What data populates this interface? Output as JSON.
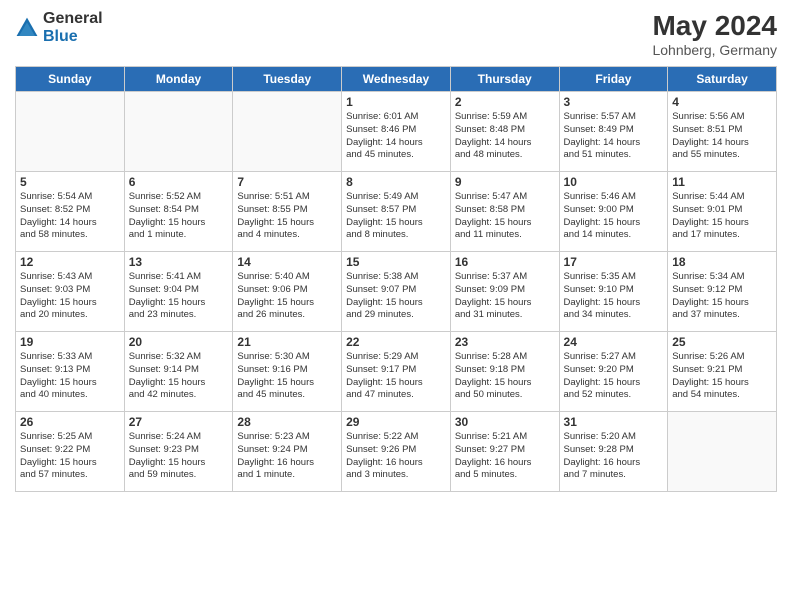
{
  "header": {
    "logo_line1": "General",
    "logo_line2": "Blue",
    "month_year": "May 2024",
    "location": "Lohnberg, Germany"
  },
  "weekdays": [
    "Sunday",
    "Monday",
    "Tuesday",
    "Wednesday",
    "Thursday",
    "Friday",
    "Saturday"
  ],
  "weeks": [
    [
      {
        "day": "",
        "info": ""
      },
      {
        "day": "",
        "info": ""
      },
      {
        "day": "",
        "info": ""
      },
      {
        "day": "1",
        "info": "Sunrise: 6:01 AM\nSunset: 8:46 PM\nDaylight: 14 hours\nand 45 minutes."
      },
      {
        "day": "2",
        "info": "Sunrise: 5:59 AM\nSunset: 8:48 PM\nDaylight: 14 hours\nand 48 minutes."
      },
      {
        "day": "3",
        "info": "Sunrise: 5:57 AM\nSunset: 8:49 PM\nDaylight: 14 hours\nand 51 minutes."
      },
      {
        "day": "4",
        "info": "Sunrise: 5:56 AM\nSunset: 8:51 PM\nDaylight: 14 hours\nand 55 minutes."
      }
    ],
    [
      {
        "day": "5",
        "info": "Sunrise: 5:54 AM\nSunset: 8:52 PM\nDaylight: 14 hours\nand 58 minutes."
      },
      {
        "day": "6",
        "info": "Sunrise: 5:52 AM\nSunset: 8:54 PM\nDaylight: 15 hours\nand 1 minute."
      },
      {
        "day": "7",
        "info": "Sunrise: 5:51 AM\nSunset: 8:55 PM\nDaylight: 15 hours\nand 4 minutes."
      },
      {
        "day": "8",
        "info": "Sunrise: 5:49 AM\nSunset: 8:57 PM\nDaylight: 15 hours\nand 8 minutes."
      },
      {
        "day": "9",
        "info": "Sunrise: 5:47 AM\nSunset: 8:58 PM\nDaylight: 15 hours\nand 11 minutes."
      },
      {
        "day": "10",
        "info": "Sunrise: 5:46 AM\nSunset: 9:00 PM\nDaylight: 15 hours\nand 14 minutes."
      },
      {
        "day": "11",
        "info": "Sunrise: 5:44 AM\nSunset: 9:01 PM\nDaylight: 15 hours\nand 17 minutes."
      }
    ],
    [
      {
        "day": "12",
        "info": "Sunrise: 5:43 AM\nSunset: 9:03 PM\nDaylight: 15 hours\nand 20 minutes."
      },
      {
        "day": "13",
        "info": "Sunrise: 5:41 AM\nSunset: 9:04 PM\nDaylight: 15 hours\nand 23 minutes."
      },
      {
        "day": "14",
        "info": "Sunrise: 5:40 AM\nSunset: 9:06 PM\nDaylight: 15 hours\nand 26 minutes."
      },
      {
        "day": "15",
        "info": "Sunrise: 5:38 AM\nSunset: 9:07 PM\nDaylight: 15 hours\nand 29 minutes."
      },
      {
        "day": "16",
        "info": "Sunrise: 5:37 AM\nSunset: 9:09 PM\nDaylight: 15 hours\nand 31 minutes."
      },
      {
        "day": "17",
        "info": "Sunrise: 5:35 AM\nSunset: 9:10 PM\nDaylight: 15 hours\nand 34 minutes."
      },
      {
        "day": "18",
        "info": "Sunrise: 5:34 AM\nSunset: 9:12 PM\nDaylight: 15 hours\nand 37 minutes."
      }
    ],
    [
      {
        "day": "19",
        "info": "Sunrise: 5:33 AM\nSunset: 9:13 PM\nDaylight: 15 hours\nand 40 minutes."
      },
      {
        "day": "20",
        "info": "Sunrise: 5:32 AM\nSunset: 9:14 PM\nDaylight: 15 hours\nand 42 minutes."
      },
      {
        "day": "21",
        "info": "Sunrise: 5:30 AM\nSunset: 9:16 PM\nDaylight: 15 hours\nand 45 minutes."
      },
      {
        "day": "22",
        "info": "Sunrise: 5:29 AM\nSunset: 9:17 PM\nDaylight: 15 hours\nand 47 minutes."
      },
      {
        "day": "23",
        "info": "Sunrise: 5:28 AM\nSunset: 9:18 PM\nDaylight: 15 hours\nand 50 minutes."
      },
      {
        "day": "24",
        "info": "Sunrise: 5:27 AM\nSunset: 9:20 PM\nDaylight: 15 hours\nand 52 minutes."
      },
      {
        "day": "25",
        "info": "Sunrise: 5:26 AM\nSunset: 9:21 PM\nDaylight: 15 hours\nand 54 minutes."
      }
    ],
    [
      {
        "day": "26",
        "info": "Sunrise: 5:25 AM\nSunset: 9:22 PM\nDaylight: 15 hours\nand 57 minutes."
      },
      {
        "day": "27",
        "info": "Sunrise: 5:24 AM\nSunset: 9:23 PM\nDaylight: 15 hours\nand 59 minutes."
      },
      {
        "day": "28",
        "info": "Sunrise: 5:23 AM\nSunset: 9:24 PM\nDaylight: 16 hours\nand 1 minute."
      },
      {
        "day": "29",
        "info": "Sunrise: 5:22 AM\nSunset: 9:26 PM\nDaylight: 16 hours\nand 3 minutes."
      },
      {
        "day": "30",
        "info": "Sunrise: 5:21 AM\nSunset: 9:27 PM\nDaylight: 16 hours\nand 5 minutes."
      },
      {
        "day": "31",
        "info": "Sunrise: 5:20 AM\nSunset: 9:28 PM\nDaylight: 16 hours\nand 7 minutes."
      },
      {
        "day": "",
        "info": ""
      }
    ]
  ]
}
